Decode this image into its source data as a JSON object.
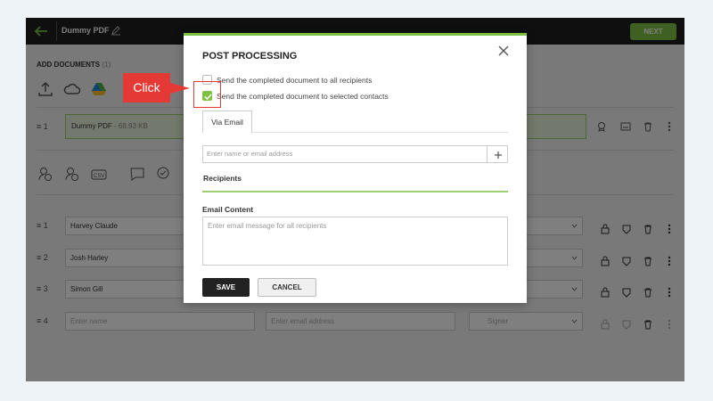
{
  "topbar": {
    "title": "Dummy PDF",
    "next_label": "NEXT"
  },
  "documents": {
    "heading": "ADD DOCUMENTS",
    "count": "(1)",
    "rows": [
      {
        "index": "1",
        "name": "Dummy PDF",
        "size": "- 68.93 KB"
      }
    ]
  },
  "recipients": [
    {
      "index": "1",
      "name": "Harvey Claude"
    },
    {
      "index": "2",
      "name": "Josh Harley"
    },
    {
      "index": "3",
      "name": "Simon Gill"
    },
    {
      "index": "4",
      "name": "",
      "name_placeholder": "Enter name",
      "email_placeholder": "Enter email address",
      "role": "Signer"
    }
  ],
  "modal": {
    "title": "POST PROCESSING",
    "option_all": "Send the completed document to all recipients",
    "option_selected": "Send the completed document to selected contacts",
    "tab_label": "Via Email",
    "email_placeholder": "Enter name or email address",
    "recipients_label": "Recipients",
    "email_content_label": "Email Content",
    "email_content_placeholder": "Enter email message for all recipients",
    "save_label": "SAVE",
    "cancel_label": "CANCEL"
  },
  "annotation": {
    "callout_text": "Click"
  },
  "colors": {
    "accent": "#7cc142",
    "callout": "#e53935",
    "topbar": "#1f1f1f"
  }
}
